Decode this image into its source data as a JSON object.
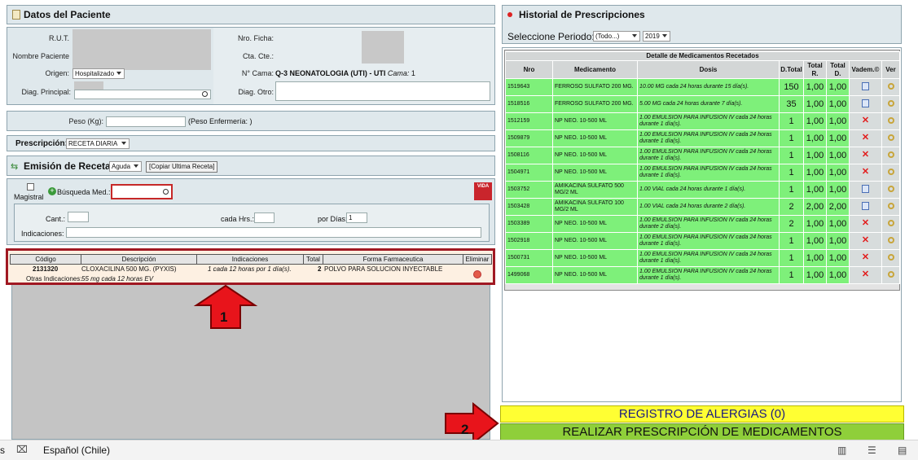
{
  "patient": {
    "title": "Datos del Paciente",
    "rut_label": "R.U.T.",
    "nombre_label": "Nombre Paciente",
    "origen_label": "Origen:",
    "origen_value": "Hospitalizado",
    "diag_label": "Diag. Principal:",
    "ficha_label": "Nro. Ficha:",
    "cta_label": "Cta. Cte.:",
    "cama_label": "N° Cama:",
    "cama_value": "Q-3 NEONATOLOGIA (UTI) - UTI",
    "cama_word": "Cama:",
    "cama_number": "1",
    "diag_otro_label": "Diag. Otro:"
  },
  "peso": {
    "label": "Peso (Kg):",
    "enfermeria": "(Peso Enfermería: )"
  },
  "prescripcion": {
    "label": "Prescripción:",
    "value": "RECETA DIARIA"
  },
  "emision": {
    "title": "Emisión de Receta",
    "tipo_value": "Aguda",
    "copy_button": "[Copiar Ultima Receta]",
    "magistral_label": "Magistral",
    "busqueda_label": "Búsqueda Med.:",
    "vida_logo": "VIDA",
    "cant_label": "Cant.:",
    "cada_label": "cada Hrs.:",
    "dias_label": "por Días:",
    "dias_value": "1",
    "indicaciones_label": "Indicaciones:"
  },
  "rx_table": {
    "headers": [
      "Código",
      "Descripción",
      "Indicaciones",
      "Total",
      "Forma Farmaceutica",
      "Eliminar"
    ],
    "row": {
      "codigo": "2131320",
      "descripcion": "CLOXACILINA 500 MG. (PYXIS)",
      "indicaciones": "1 cada 12 horas por 1 día(s).",
      "total": "2",
      "forma": "POLVO PARA SOLUCION INYECTABLE",
      "otras_label": "Otras Indicaciones:",
      "otras_value": "55 mg cada 12 horas EV"
    }
  },
  "annotations": {
    "one": "1",
    "two": "2"
  },
  "history": {
    "title": "Historial de Prescripciones",
    "periodo_label": "Seleccione Periodo:",
    "periodo_value": "(Todo...)",
    "year_value": "2019",
    "detail_title": "Detalle de Medicamentos Recetados",
    "headers": [
      "Nro",
      "Medicamento",
      "Dosis",
      "D.Total",
      "Total R.",
      "Total D.",
      "Vadem.©",
      "Ver"
    ],
    "rows": [
      {
        "nro": "1519643",
        "med": "FERROSO SULFATO 200 MG.",
        "dosis": "10.00 MG cada 24 horas durante 15 día(s).",
        "dtotal": "150",
        "totr": "1,00",
        "totd": "1,00",
        "vadem": "book"
      },
      {
        "nro": "1518516",
        "med": "FERROSO SULFATO 200 MG.",
        "dosis": "5.00 MG cada 24 horas durante 7 día(s).",
        "dtotal": "35",
        "totr": "1,00",
        "totd": "1,00",
        "vadem": "book"
      },
      {
        "nro": "1512159",
        "med": "NP NEO. 10-500 ML",
        "dosis": "1.00 EMULSION PARA INFUSION IV cada 24 horas durante 1 día(s).",
        "dtotal": "1",
        "totr": "1,00",
        "totd": "1,00",
        "vadem": "x"
      },
      {
        "nro": "1509879",
        "med": "NP NEO. 10-500 ML",
        "dosis": "1.00 EMULSION PARA INFUSION IV cada 24 horas durante 1 día(s).",
        "dtotal": "1",
        "totr": "1,00",
        "totd": "1,00",
        "vadem": "x"
      },
      {
        "nro": "1508116",
        "med": "NP NEO. 10-500 ML",
        "dosis": "1.00 EMULSION PARA INFUSION IV cada 24 horas durante 1 día(s).",
        "dtotal": "1",
        "totr": "1,00",
        "totd": "1,00",
        "vadem": "x"
      },
      {
        "nro": "1504971",
        "med": "NP NEO. 10-500 ML",
        "dosis": "1.00 EMULSION PARA INFUSION IV cada 24 horas durante 1 día(s).",
        "dtotal": "1",
        "totr": "1,00",
        "totd": "1,00",
        "vadem": "x"
      },
      {
        "nro": "1503752",
        "med": "AMIKACINA SULFATO 500 MG/2 ML",
        "dosis": "1.00 VIAL cada 24 horas durante 1 día(s).",
        "dtotal": "1",
        "totr": "1,00",
        "totd": "1,00",
        "vadem": "book"
      },
      {
        "nro": "1503428",
        "med": "AMIKACINA SULFATO 100 MG/2 ML",
        "dosis": "1.00 VIAL cada 24 horas durante 2 día(s).",
        "dtotal": "2",
        "totr": "2,00",
        "totd": "2,00",
        "vadem": "book"
      },
      {
        "nro": "1503389",
        "med": "NP NEO. 10-500 ML",
        "dosis": "1.00 EMULSION PARA INFUSION IV cada 24 horas durante 2 día(s).",
        "dtotal": "2",
        "totr": "1,00",
        "totd": "1,00",
        "vadem": "x"
      },
      {
        "nro": "1502918",
        "med": "NP NEO. 10-500 ML",
        "dosis": "1.00 EMULSION PARA INFUSION IV cada 24 horas durante 1 día(s).",
        "dtotal": "1",
        "totr": "1,00",
        "totd": "1,00",
        "vadem": "x"
      },
      {
        "nro": "1500731",
        "med": "NP NEO. 10-500 ML",
        "dosis": "1.00 EMULSION PARA INFUSION IV cada 24 horas durante 1 día(s).",
        "dtotal": "1",
        "totr": "1,00",
        "totd": "1,00",
        "vadem": "x"
      },
      {
        "nro": "1499068",
        "med": "NP NEO. 10-500 ML",
        "dosis": "1.00 EMULSION PARA INFUSION IV cada 24 horas durante 1 día(s).",
        "dtotal": "1",
        "totr": "1,00",
        "totd": "1,00",
        "vadem": "x"
      }
    ]
  },
  "actions": {
    "alergias": "REGISTRO DE ALERGIAS (0)",
    "realizar": "REALIZAR PRESCRIPCIÓN DE MEDICAMENTOS"
  },
  "taskbar": {
    "language": "Español (Chile)",
    "left_char": "s"
  },
  "colors": {
    "panel_bg": "#dfe8ec",
    "row_green": "#7ef07a",
    "highlight_red": "#a01822",
    "arrow_red": "#e8141b",
    "yellow": "#ffff33",
    "green_bar": "#8fcf3a"
  }
}
